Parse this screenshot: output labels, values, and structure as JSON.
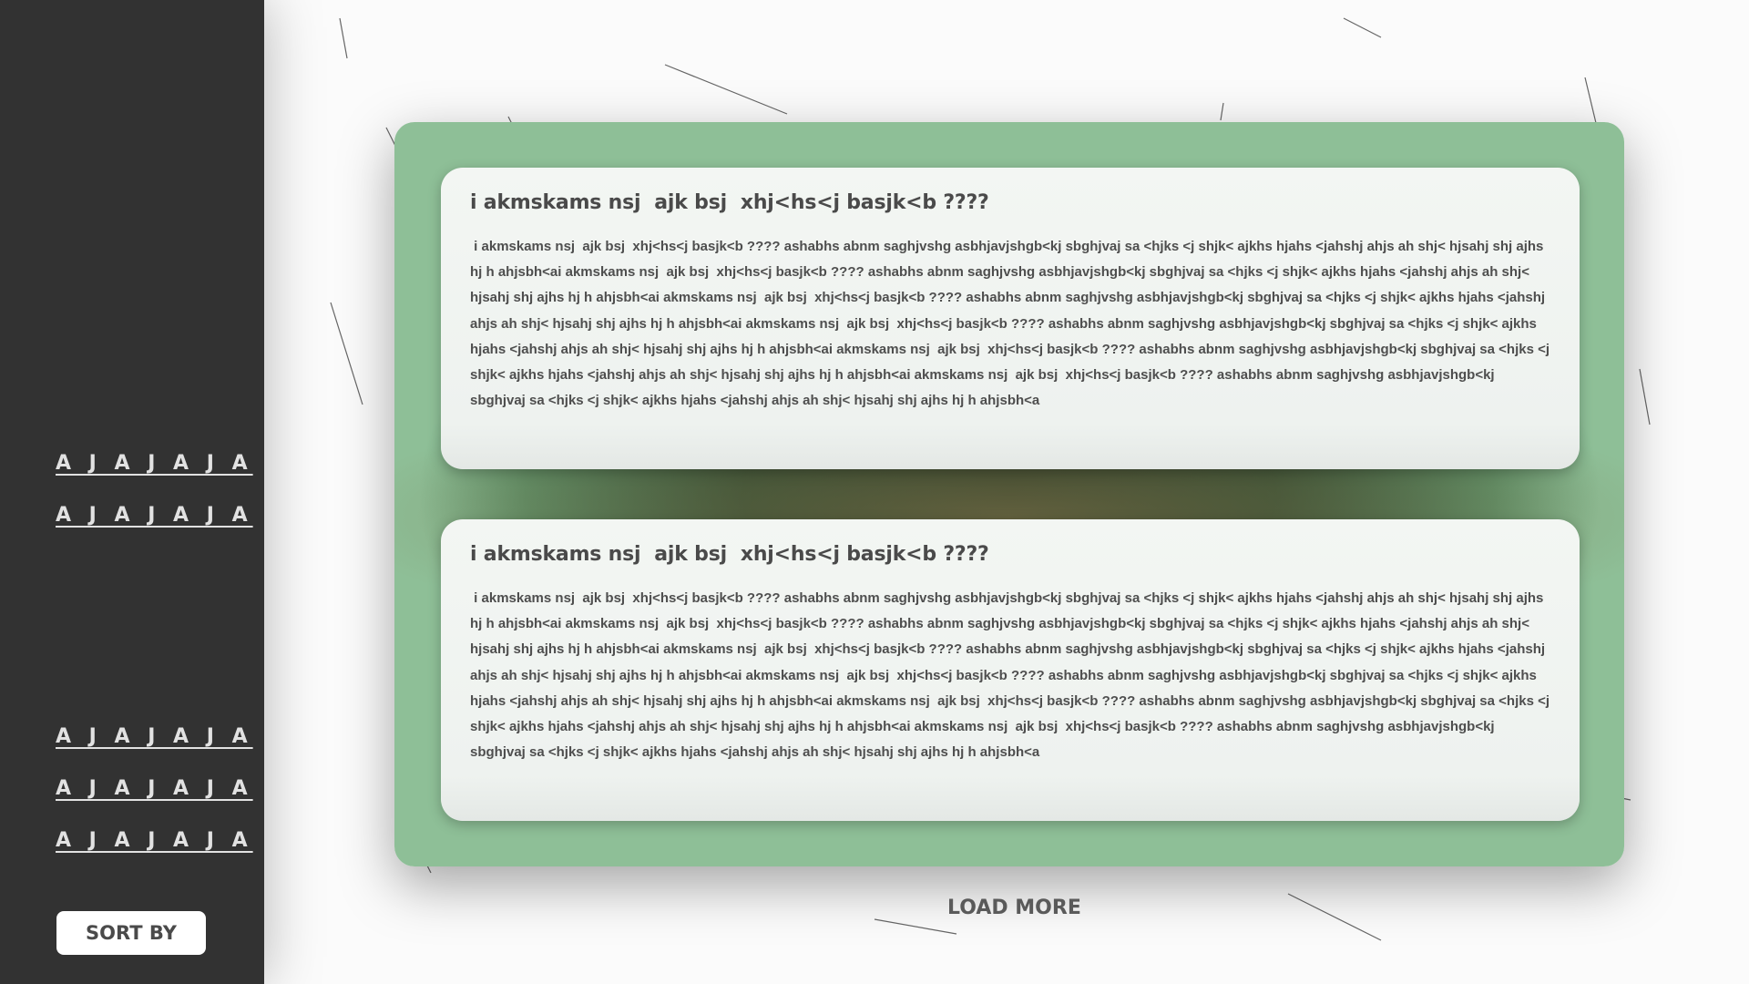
{
  "sidebar": {
    "top_links": [
      "A J A J A J A",
      "A J A J A J A"
    ],
    "bottom_links": [
      "A J A J A J A",
      "A J A J A J A",
      "A J A J A J A"
    ],
    "sort_label": "SORT BY"
  },
  "feed": {
    "posts": [
      {
        "title": "i akmskams nsj  ajk bsj  xhj<hs<j basjk<b ????",
        "body": " i akmskams nsj  ajk bsj  xhj<hs<j basjk<b ???? ashabhs abnm saghjvshg asbhjavjshgb<kj sbghjvaj sa <hjks <j shjk< ajkhs hjahs <jahshj ahjs ah shj< hjsahj shj ajhs hj h ahjsbh<ai akmskams nsj  ajk bsj  xhj<hs<j basjk<b ???? ashabhs abnm saghjvshg asbhjavjshgb<kj sbghjvaj sa <hjks <j shjk< ajkhs hjahs <jahshj ahjs ah shj< hjsahj shj ajhs hj h ahjsbh<ai akmskams nsj  ajk bsj  xhj<hs<j basjk<b ???? ashabhs abnm saghjvshg asbhjavjshgb<kj sbghjvaj sa <hjks <j shjk< ajkhs hjahs <jahshj ahjs ah shj< hjsahj shj ajhs hj h ahjsbh<ai akmskams nsj  ajk bsj  xhj<hs<j basjk<b ???? ashabhs abnm saghjvshg asbhjavjshgb<kj sbghjvaj sa <hjks <j shjk< ajkhs hjahs <jahshj ahjs ah shj< hjsahj shj ajhs hj h ahjsbh<ai akmskams nsj  ajk bsj  xhj<hs<j basjk<b ???? ashabhs abnm saghjvshg asbhjavjshgb<kj sbghjvaj sa <hjks <j shjk< ajkhs hjahs <jahshj ahjs ah shj< hjsahj shj ajhs hj h ahjsbh<ai akmskams nsj  ajk bsj  xhj<hs<j basjk<b ???? ashabhs abnm saghjvshg asbhjavjshgb<kj sbghjvaj sa <hjks <j shjk< ajkhs hjahs <jahshj ahjs ah shj< hjsahj shj ajhs hj h ahjsbh<a"
      },
      {
        "title": "i akmskams nsj  ajk bsj  xhj<hs<j basjk<b ????",
        "body": " i akmskams nsj  ajk bsj  xhj<hs<j basjk<b ???? ashabhs abnm saghjvshg asbhjavjshgb<kj sbghjvaj sa <hjks <j shjk< ajkhs hjahs <jahshj ahjs ah shj< hjsahj shj ajhs hj h ahjsbh<ai akmskams nsj  ajk bsj  xhj<hs<j basjk<b ???? ashabhs abnm saghjvshg asbhjavjshgb<kj sbghjvaj sa <hjks <j shjk< ajkhs hjahs <jahshj ahjs ah shj< hjsahj shj ajhs hj h ahjsbh<ai akmskams nsj  ajk bsj  xhj<hs<j basjk<b ???? ashabhs abnm saghjvshg asbhjavjshgb<kj sbghjvaj sa <hjks <j shjk< ajkhs hjahs <jahshj ahjs ah shj< hjsahj shj ajhs hj h ahjsbh<ai akmskams nsj  ajk bsj  xhj<hs<j basjk<b ???? ashabhs abnm saghjvshg asbhjavjshgb<kj sbghjvaj sa <hjks <j shjk< ajkhs hjahs <jahshj ahjs ah shj< hjsahj shj ajhs hj h ahjsbh<ai akmskams nsj  ajk bsj  xhj<hs<j basjk<b ???? ashabhs abnm saghjvshg asbhjavjshgb<kj sbghjvaj sa <hjks <j shjk< ajkhs hjahs <jahshj ahjs ah shj< hjsahj shj ajhs hj h ahjsbh<ai akmskams nsj  ajk bsj  xhj<hs<j basjk<b ???? ashabhs abnm saghjvshg asbhjavjshgb<kj sbghjvaj sa <hjks <j shjk< ajkhs hjahs <jahshj ahjs ah shj< hjsahj shj ajhs hj h ahjsbh<a"
      }
    ],
    "load_more_label": "LOAD MORE"
  },
  "colors": {
    "sidebar_bg": "#323232",
    "frame_green": "#8ebf97",
    "frame_dark": "#1d3423",
    "card_bg": "#eef2ef",
    "text_dark": "#4a4a4a"
  }
}
